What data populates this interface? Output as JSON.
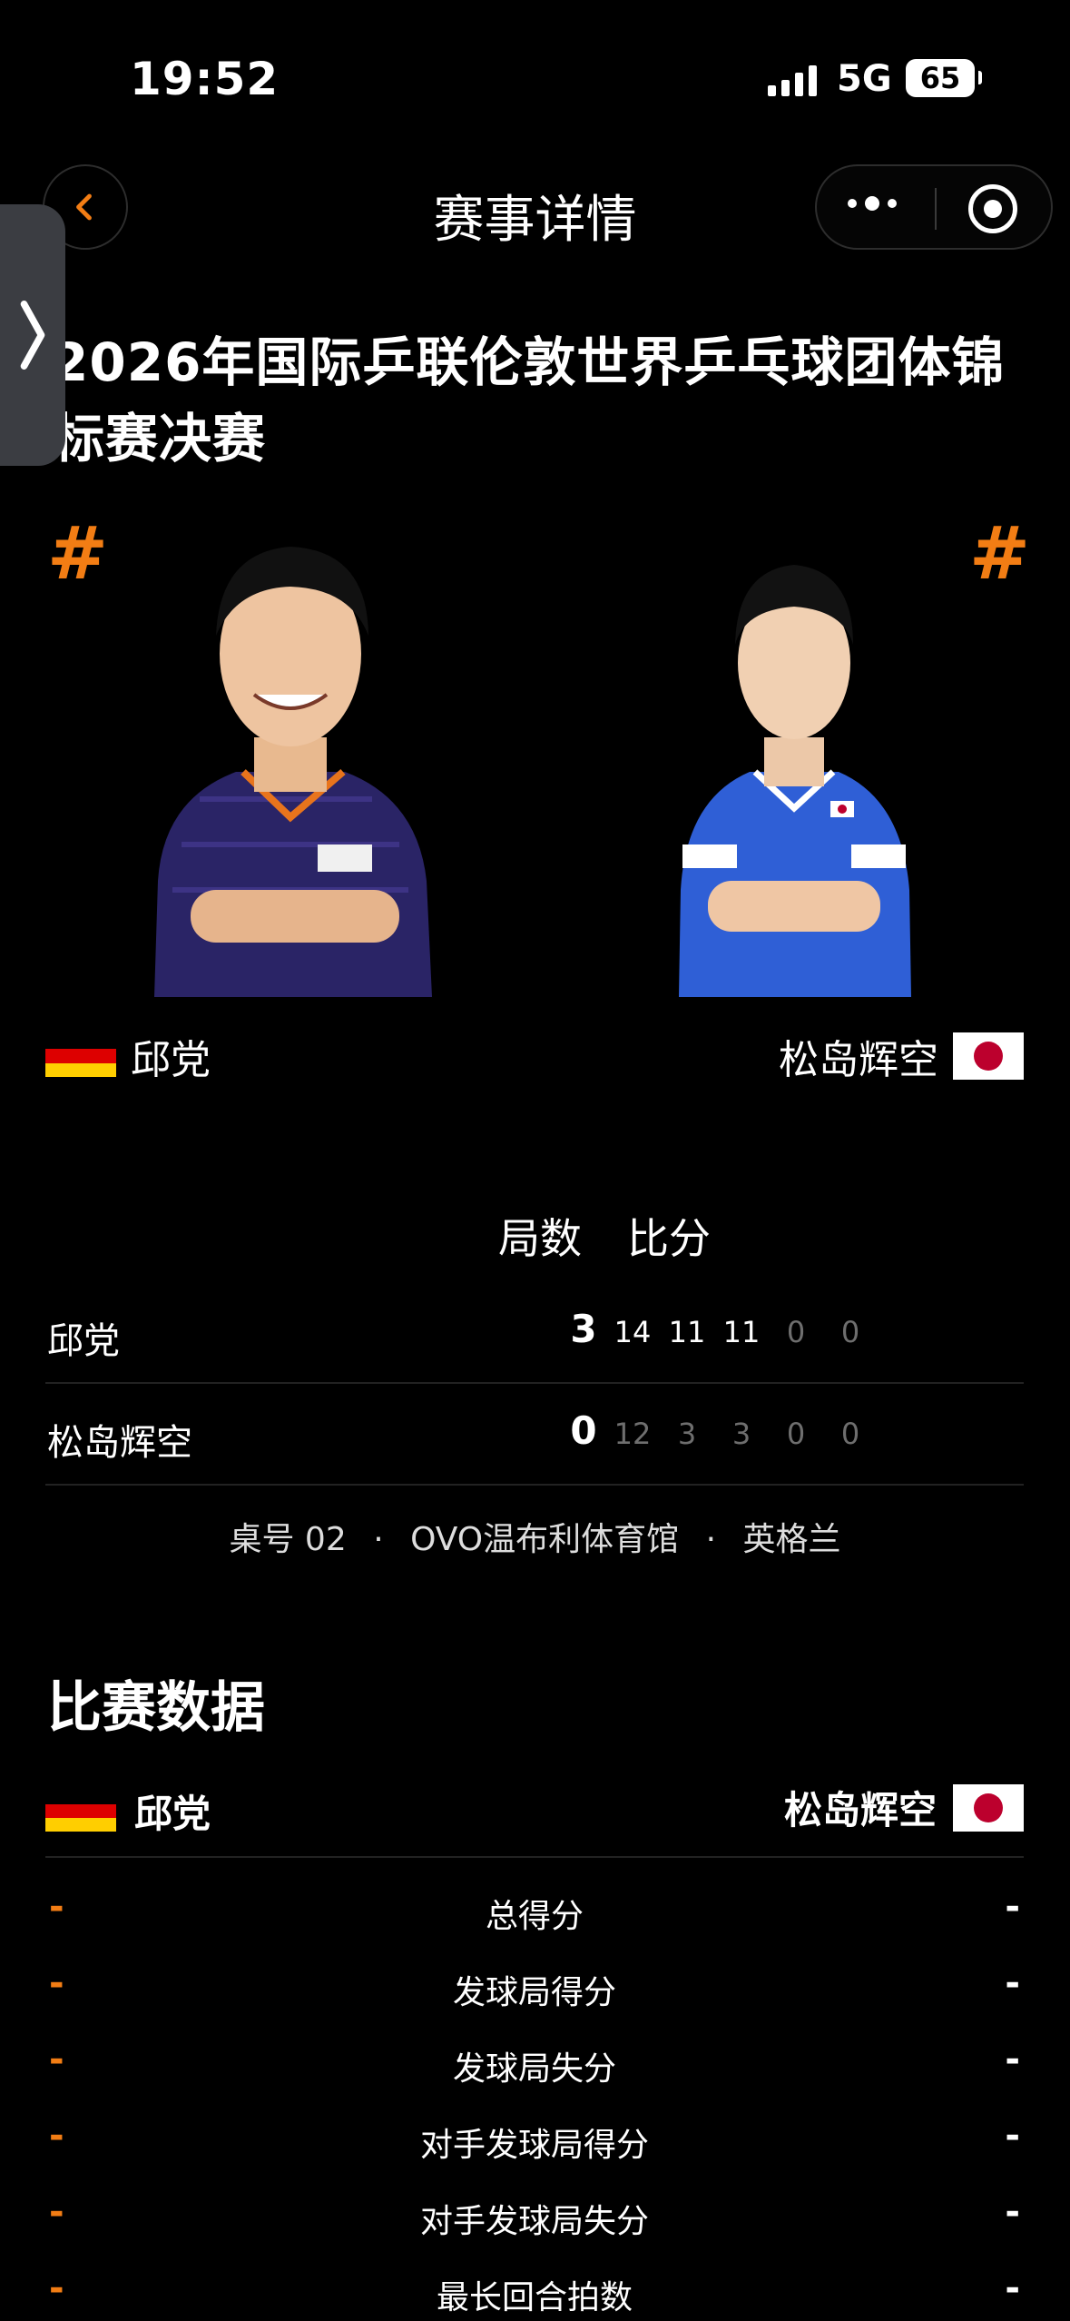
{
  "status_bar": {
    "time": "19:52",
    "network": "5G",
    "battery": "65"
  },
  "nav": {
    "title": "赛事详情"
  },
  "event": {
    "title": "2026年国际乒联伦敦世界乒乓球团体锦标赛决赛"
  },
  "players": {
    "left": {
      "name": "邱党",
      "country": "germany",
      "seed_mark": "#"
    },
    "right": {
      "name": "松岛辉空",
      "country": "japan",
      "seed_mark": "#"
    }
  },
  "score_table": {
    "games_header": "局数",
    "points_header": "比分",
    "rows": [
      {
        "name": "邱党",
        "games": "3",
        "scores": [
          "14",
          "11",
          "11",
          "0",
          "0"
        ]
      },
      {
        "name": "松岛辉空",
        "games": "0",
        "scores": [
          "12",
          "3",
          "3",
          "0",
          "0"
        ]
      }
    ],
    "meta": {
      "table": "桌号 02",
      "venue": "OVO温布利体育馆",
      "country": "英格兰",
      "separator": "·"
    }
  },
  "match_stats": {
    "title": "比赛数据",
    "left_player": "邱党",
    "right_player": "松岛辉空",
    "rows": [
      {
        "label": "总得分",
        "left": "-",
        "right": "-"
      },
      {
        "label": "发球局得分",
        "left": "-",
        "right": "-"
      },
      {
        "label": "发球局失分",
        "left": "-",
        "right": "-"
      },
      {
        "label": "对手发球局得分",
        "left": "-",
        "right": "-"
      },
      {
        "label": "对手发球局失分",
        "left": "-",
        "right": "-"
      },
      {
        "label": "最长回合拍数",
        "left": "-",
        "right": "-"
      }
    ]
  },
  "colors": {
    "accent": "#f27d14",
    "background": "#000000",
    "muted_score": "#6e6e6e",
    "germany": [
      "#000000",
      "#dd0000",
      "#ffce00"
    ],
    "japan_red": "#bc002d"
  }
}
